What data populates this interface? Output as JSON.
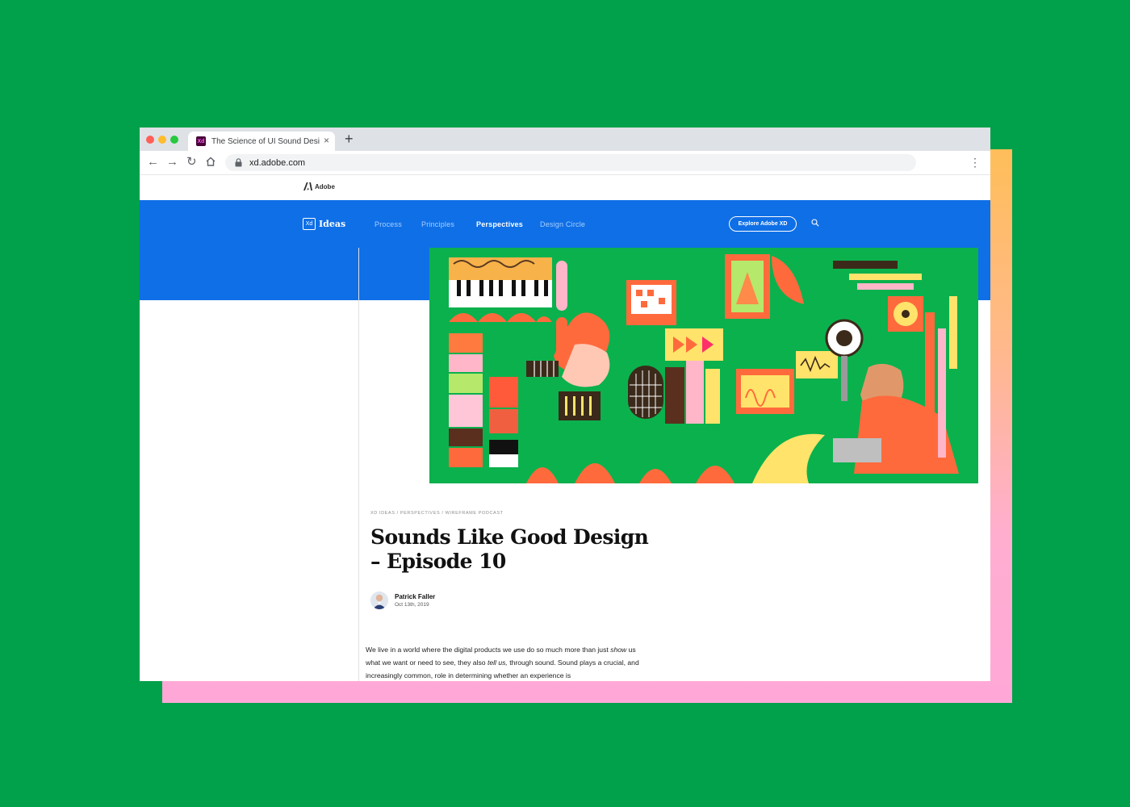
{
  "browser": {
    "tab_title": "The Science of UI Sound Desig",
    "favicon_text": "Xd",
    "new_tab_symbol": "+",
    "close_symbol": "×",
    "url": "xd.adobe.com"
  },
  "site": {
    "adobe_label": "Adobe",
    "brand_box": "Xd",
    "brand_name": "Ideas",
    "nav": [
      "Process",
      "Principles",
      "Perspectives",
      "Design Circle"
    ],
    "active_nav": "Perspectives",
    "cta_label": "Explore Adobe XD"
  },
  "article": {
    "breadcrumb": "XD IDEAS  /  PERSPECTIVES  /  WIREFRAME PODCAST",
    "title": "Sounds Like Good Design – Episode 10",
    "author": "Patrick Faller",
    "date": "Oct 13th, 2019",
    "body": {
      "p1": "We live in a world where the digital products we use do so much more than just ",
      "em1": "show",
      "p2": " us what we want or need to see, they also ",
      "em2": "tell us,",
      "p3": " through sound.  Sound plays a crucial, and increasingly common, role in determining whether an experience is"
    }
  },
  "icons": [
    "back-arrow-icon",
    "forward-arrow-icon",
    "reload-icon",
    "home-icon",
    "lock-icon",
    "kebab-menu-icon",
    "adobe-logo-icon",
    "search-icon"
  ],
  "colors": {
    "background": "#01a04a",
    "nav_blue": "#0f6fe6",
    "hero_green": "#0bb14d",
    "backdrop_top": "#ffbe5a",
    "backdrop_bottom": "#ffa8d8"
  }
}
